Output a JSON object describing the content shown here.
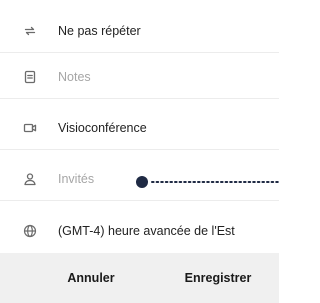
{
  "rows": {
    "repeat": {
      "label": "Ne pas répéter",
      "icon": "repeat-icon"
    },
    "notes": {
      "placeholder": "Notes",
      "icon": "notes-icon"
    },
    "video": {
      "label": "Visioconférence",
      "icon": "video-icon"
    },
    "guests": {
      "placeholder": "Invités",
      "icon": "person-icon"
    },
    "timezone": {
      "label": "(GMT-4) heure avancée de l'Est",
      "icon": "globe-icon"
    }
  },
  "footer": {
    "cancel_label": "Annuler",
    "save_label": "Enregistrer"
  },
  "colors": {
    "placeholder_text": "#a6a6a6",
    "primary_text": "#222222",
    "icon": "#6b6b6b",
    "footer_bg": "#f0f0f0",
    "pointer": "#1f2a44"
  }
}
